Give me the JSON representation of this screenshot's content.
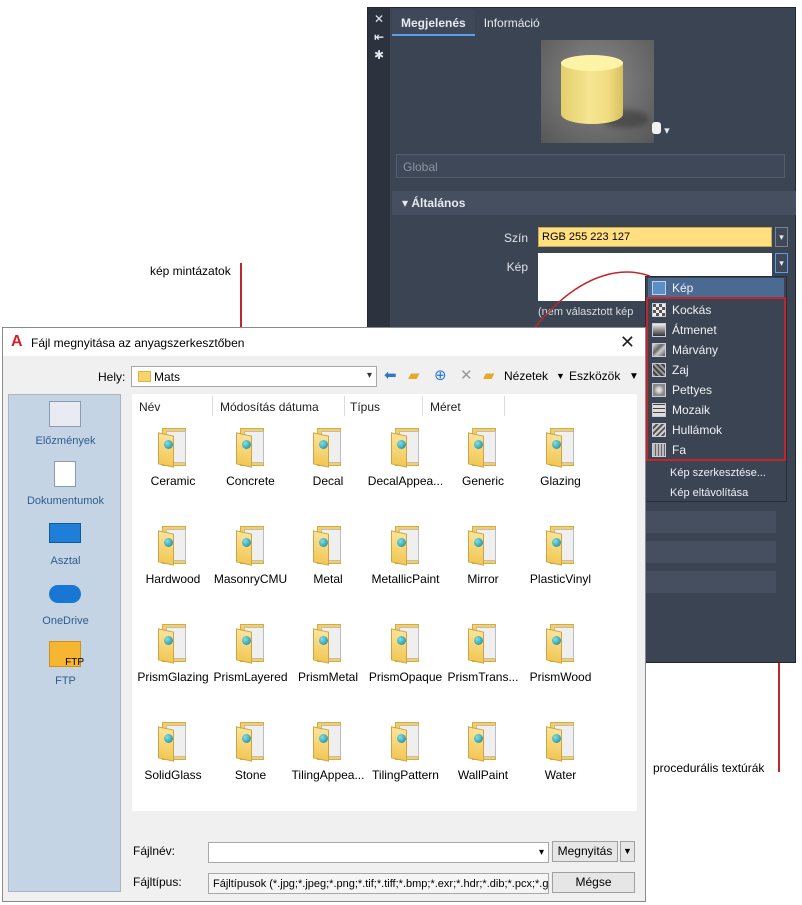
{
  "annotations": {
    "pattern_label": "kép mintázatok",
    "procedural_label": "procedurális textúrák",
    "accent_red": "#c0272d"
  },
  "editor": {
    "side_icons": [
      "close-icon",
      "collapse-icon",
      "settings-icon"
    ],
    "tabs": [
      "Megjelenés",
      "Információ"
    ],
    "class_field": "Global",
    "section": "Általános",
    "color_label": "Szín",
    "color_value": "RGB 255 223 127",
    "color_hex": "#ffdf7f",
    "image_label": "Kép",
    "image_none_text": "(nem választott kép"
  },
  "menu": {
    "header": "Kép",
    "procedural_items": [
      "Kockás",
      "Átmenet",
      "Márvány",
      "Zaj",
      "Pettyes",
      "Mozaik",
      "Hullámok",
      "Fa"
    ],
    "actions": [
      "Kép szerkesztése...",
      "Kép eltávolítása"
    ]
  },
  "dialog": {
    "title": "Fájl megnyitása az anyagszerkesztőben",
    "location_label": "Hely:",
    "location_value": "Mats",
    "views_label": "Nézetek",
    "tools_label": "Eszközök",
    "places": [
      "Előzmények",
      "Dokumentumok",
      "Asztal",
      "OneDrive",
      "FTP"
    ],
    "ftp_icon_text": "FTP",
    "columns": [
      "Név",
      "Módosítás dátuma",
      "Típus",
      "Méret"
    ],
    "files": [
      "Ceramic",
      "Concrete",
      "Decal",
      "DecalAppea...",
      "Generic",
      "Glazing",
      "Hardwood",
      "MasonryCMU",
      "Metal",
      "MetallicPaint",
      "Mirror",
      "PlasticVinyl",
      "PrismGlazing",
      "PrismLayered",
      "PrismMetal",
      "PrismOpaque",
      "PrismTrans...",
      "PrismWood",
      "SolidGlass",
      "Stone",
      "TilingAppea...",
      "TilingPattern",
      "WallPaint",
      "Water"
    ],
    "filename_label": "Fájlnév:",
    "filename_value": "",
    "filetype_label": "Fájltípus:",
    "filetype_value": "Fájltípusok (*.jpg;*.jpeg;*.png;*.tif;*.tiff;*.bmp;*.exr;*.hdr;*.dib;*.pcx;*.g",
    "open_button": "Megnyitás",
    "cancel_button": "Mégse"
  }
}
